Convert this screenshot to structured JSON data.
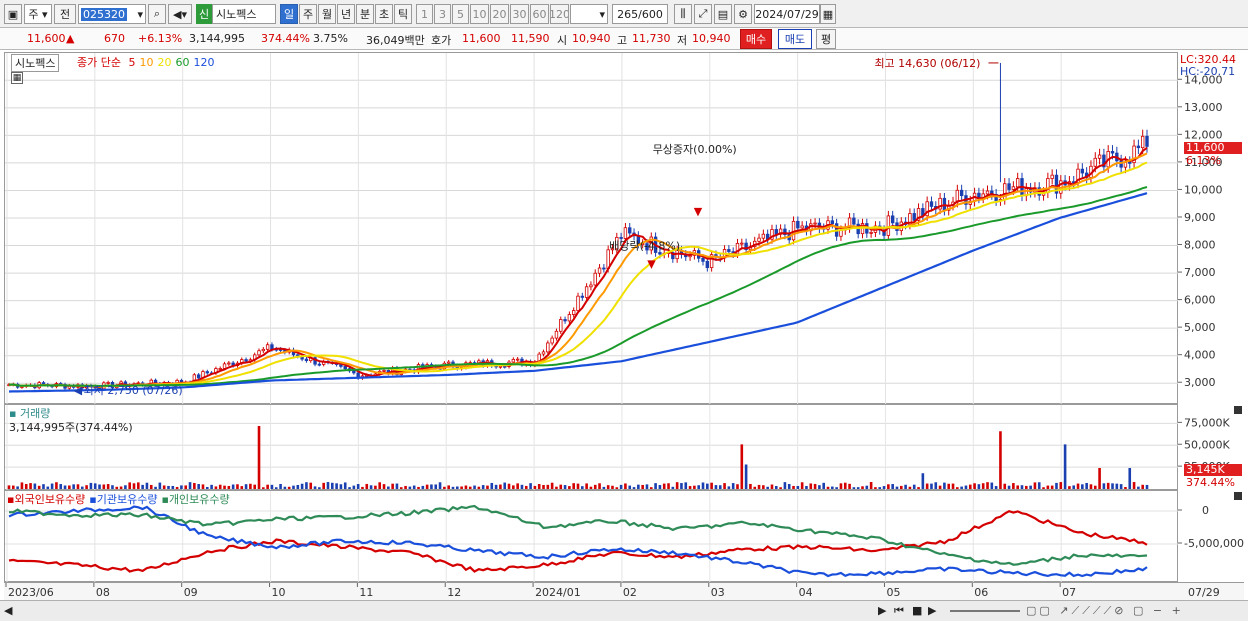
{
  "toolbar": {
    "type_select": "주",
    "prev_button": "전",
    "code_value": "025320",
    "sound_menu": "◀",
    "credit_badge": "신",
    "stock_name": "시노펙스",
    "period_tabs": [
      "일",
      "주",
      "월",
      "년",
      "분",
      "초",
      "틱"
    ],
    "active_period": "일",
    "interval_buttons": [
      "1",
      "3",
      "5",
      "10",
      "20",
      "30",
      "60",
      "120"
    ],
    "bar_count": "265",
    "bar_total": "/600",
    "date_value": "2024/07/29"
  },
  "quote": {
    "price": "11,600",
    "change_arrow": "▲",
    "change": "670",
    "change_pct": "+6.13%",
    "volume": "3,144,995",
    "volume_ratio": "374.44%",
    "turnover": "3.75%",
    "amount": "36,049백만",
    "bid_label": "호가",
    "ask": "11,600",
    "bid": "11,590",
    "open_label": "시",
    "open": "10,940",
    "high_label": "고",
    "high": "11,730",
    "low_label": "저",
    "low": "10,940",
    "buy_button": "매수",
    "sell_button": "매도",
    "eval_button": "평"
  },
  "price_panel": {
    "name_tag": "시노펙스",
    "ma_label": "종가 단순",
    "ma_periods": [
      "5",
      "10",
      "20",
      "60",
      "120"
    ],
    "ma_colors": [
      "#d40000",
      "#ff9900",
      "#f0e000",
      "#1a9a2a",
      "#1a4fdc"
    ],
    "lc": "LC:320.44",
    "hc": "HC:-20.71",
    "current_price_tag": "11,600",
    "current_pct_tag": "6.13%",
    "annotations": {
      "high": "최고 14,630 (06/12)",
      "low": "최저 2,750 (07/26)",
      "rights": "무상증자(0.00%)",
      "dividend": "배당락(-4.8%)"
    },
    "y_ticks": [
      "14,000",
      "13,000",
      "12,000",
      "11,000",
      "10,000",
      "9,000",
      "8,000",
      "7,000",
      "6,000",
      "5,000",
      "4,000",
      "3,000"
    ]
  },
  "volume_panel": {
    "title": "거래량",
    "value": "3,144,995주(374.44%)",
    "y_ticks": [
      "75,000K",
      "50,000K",
      "25,000K"
    ],
    "tag_value": "3,145K",
    "tag_pct": "374.44%"
  },
  "investor_panel": {
    "legends": [
      "외국인보유수량",
      "기관보유수량",
      "개인보유수량"
    ],
    "colors": [
      "#d40000",
      "#1a4fdc",
      "#2e8b57"
    ],
    "y_ticks": [
      "0",
      "-5,000,000"
    ]
  },
  "x_axis": {
    "labels": [
      "2023/06",
      "08",
      "09",
      "10",
      "11",
      "12",
      "2024/01",
      "02",
      "03",
      "04",
      "05",
      "06",
      "07"
    ],
    "right_label": "07/29"
  },
  "chart_data": {
    "type": "candlestick",
    "title": "시노펙스",
    "x": [
      "2023/06",
      "07",
      "08",
      "09",
      "10",
      "11",
      "12",
      "2024/01",
      "02",
      "03",
      "04",
      "05",
      "06",
      "07"
    ],
    "price_close_approx": [
      2950,
      2900,
      3050,
      4300,
      3300,
      3650,
      3800,
      8400,
      7400,
      8600,
      8700,
      9900,
      10300,
      11600
    ],
    "ma120_approx": [
      2700,
      2750,
      2850,
      3100,
      3200,
      3300,
      3450,
      3800,
      4500,
      5200,
      6500,
      7800,
      9000,
      9900
    ],
    "ylim": [
      2500,
      14700
    ],
    "high": {
      "value": 14630,
      "date": "06/12"
    },
    "low": {
      "value": 2750,
      "date": "07/26"
    }
  }
}
